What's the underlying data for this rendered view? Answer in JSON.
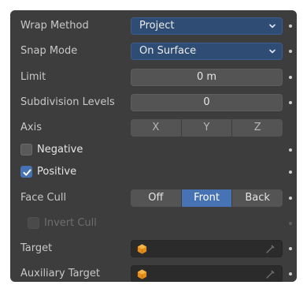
{
  "wrap_method": {
    "label": "Wrap Method",
    "value": "Project"
  },
  "snap_mode": {
    "label": "Snap Mode",
    "value": "On Surface"
  },
  "limit": {
    "label": "Limit",
    "value": "0 m"
  },
  "subdivision_levels": {
    "label": "Subdivision Levels",
    "value": "0"
  },
  "axis": {
    "label": "Axis",
    "options": [
      "X",
      "Y",
      "Z"
    ]
  },
  "negative": {
    "label": "Negative",
    "checked": false
  },
  "positive": {
    "label": "Positive",
    "checked": true
  },
  "face_cull": {
    "label": "Face Cull",
    "options": [
      "Off",
      "Front",
      "Back"
    ],
    "selected": "Front"
  },
  "invert_cull": {
    "label": "Invert Cull",
    "checked": false,
    "enabled": false
  },
  "target": {
    "label": "Target",
    "value": ""
  },
  "auxiliary_target": {
    "label": "Auxiliary Target",
    "value": ""
  },
  "colors": {
    "panel_bg": "#3d3d3d",
    "accent": "#4772b3",
    "dropdown_bg": "#2e4c74",
    "field_bg": "#545454"
  },
  "icons": [
    "chevron-down-icon",
    "checkmark-icon",
    "object-cube-icon",
    "eyedropper-icon",
    "decorator-dot-icon"
  ]
}
